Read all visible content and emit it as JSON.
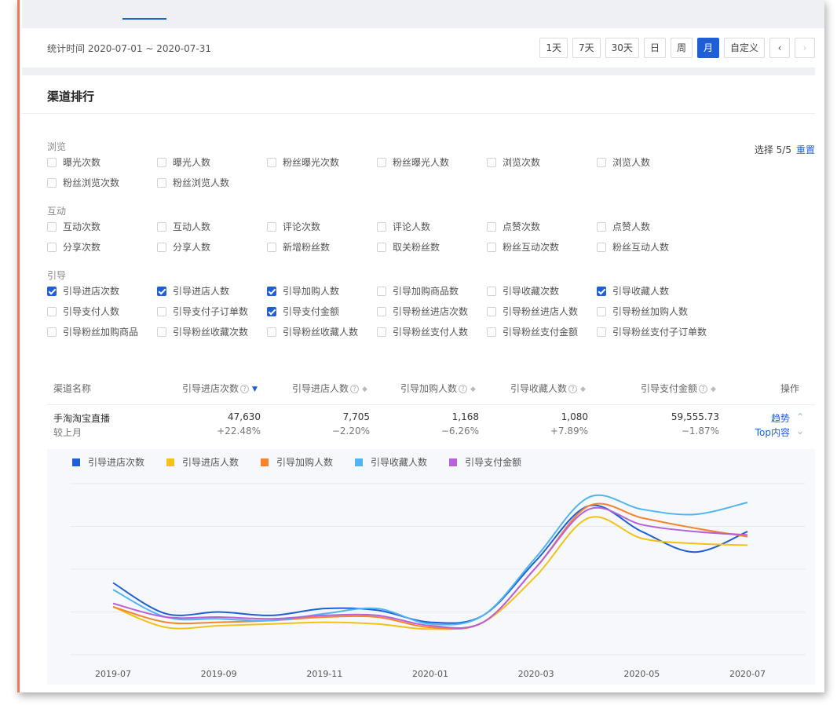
{
  "stat": {
    "label": "统计时间 2020-07-01 ~ 2020-07-31",
    "buttons": [
      "1天",
      "7天",
      "30天",
      "日",
      "周",
      "月",
      "自定义"
    ],
    "active_button": "月",
    "prev_icon": "‹",
    "next_icon": "›"
  },
  "panel": {
    "title": "渠道排行",
    "select_info": "选择 5/5",
    "reset_label": "重置"
  },
  "groups": [
    {
      "title": "浏览",
      "items": [
        {
          "label": "曝光次数",
          "checked": false
        },
        {
          "label": "曝光人数",
          "checked": false
        },
        {
          "label": "粉丝曝光次数",
          "checked": false
        },
        {
          "label": "粉丝曝光人数",
          "checked": false
        },
        {
          "label": "浏览次数",
          "checked": false
        },
        {
          "label": "浏览人数",
          "checked": false
        },
        {
          "label": "粉丝浏览次数",
          "checked": false
        },
        {
          "label": "粉丝浏览人数",
          "checked": false
        }
      ]
    },
    {
      "title": "互动",
      "items": [
        {
          "label": "互动次数",
          "checked": false
        },
        {
          "label": "互动人数",
          "checked": false
        },
        {
          "label": "评论次数",
          "checked": false
        },
        {
          "label": "评论人数",
          "checked": false
        },
        {
          "label": "点赞次数",
          "checked": false
        },
        {
          "label": "点赞人数",
          "checked": false
        },
        {
          "label": "分享次数",
          "checked": false
        },
        {
          "label": "分享人数",
          "checked": false
        },
        {
          "label": "新增粉丝数",
          "checked": false
        },
        {
          "label": "取关粉丝数",
          "checked": false
        },
        {
          "label": "粉丝互动次数",
          "checked": false
        },
        {
          "label": "粉丝互动人数",
          "checked": false
        }
      ]
    },
    {
      "title": "引导",
      "items": [
        {
          "label": "引导进店次数",
          "checked": true
        },
        {
          "label": "引导进店人数",
          "checked": true
        },
        {
          "label": "引导加购人数",
          "checked": true
        },
        {
          "label": "引导加购商品数",
          "checked": false
        },
        {
          "label": "引导收藏次数",
          "checked": false
        },
        {
          "label": "引导收藏人数",
          "checked": true
        },
        {
          "label": "引导支付人数",
          "checked": false
        },
        {
          "label": "引导支付子订单数",
          "checked": false
        },
        {
          "label": "引导支付金额",
          "checked": true
        },
        {
          "label": "引导粉丝进店次数",
          "checked": false
        },
        {
          "label": "引导粉丝进店人数",
          "checked": false
        },
        {
          "label": "引导粉丝加购人数",
          "checked": false
        },
        {
          "label": "引导粉丝加购商品",
          "checked": false
        },
        {
          "label": "引导粉丝收藏次数",
          "checked": false
        },
        {
          "label": "引导粉丝收藏人数",
          "checked": false
        },
        {
          "label": "引导粉丝支付人数",
          "checked": false
        },
        {
          "label": "引导粉丝支付金额",
          "checked": false
        },
        {
          "label": "引导粉丝支付子订单数",
          "checked": false
        }
      ]
    }
  ],
  "table": {
    "headers": {
      "channel": "渠道名称",
      "c1": "引导进店次数",
      "c2": "引导进店人数",
      "c3": "引导加购人数",
      "c4": "引导收藏人数",
      "c5": "引导支付金额",
      "op": "操作"
    },
    "row": {
      "name": "手淘淘宝直播",
      "compare_label": "较上月",
      "values": [
        "47,630",
        "7,705",
        "1,168",
        "1,080",
        "59,555.73"
      ],
      "changes": [
        "+22.48%",
        "−2.20%",
        "−6.26%",
        "+7.89%",
        "−1.87%"
      ],
      "trend_link": "趋势",
      "top_link": "Top内容"
    }
  },
  "colors": {
    "accent": "#1f5fd6"
  },
  "chart_data": {
    "type": "line",
    "x": [
      "2019-07",
      "2019-08",
      "2019-09",
      "2019-10",
      "2019-11",
      "2019-12",
      "2020-01",
      "2020-02",
      "2020-03",
      "2020-04",
      "2020-05",
      "2020-06",
      "2020-07"
    ],
    "xticks": [
      "2019-07",
      "2019-09",
      "2019-11",
      "2020-01",
      "2020-03",
      "2020-05",
      "2020-07"
    ],
    "series": [
      {
        "name": "引导进店次数",
        "color": "#1f5fd6",
        "values": [
          0.42,
          0.24,
          0.25,
          0.23,
          0.27,
          0.26,
          0.19,
          0.23,
          0.55,
          0.87,
          0.72,
          0.6,
          0.72
        ]
      },
      {
        "name": "引导进店人数",
        "color": "#f2c215",
        "values": [
          0.28,
          0.16,
          0.17,
          0.18,
          0.19,
          0.18,
          0.15,
          0.19,
          0.46,
          0.8,
          0.68,
          0.65,
          0.64
        ]
      },
      {
        "name": "引导加购人数",
        "color": "#f6832d",
        "values": [
          0.28,
          0.19,
          0.19,
          0.2,
          0.22,
          0.22,
          0.16,
          0.19,
          0.51,
          0.87,
          0.8,
          0.74,
          0.69
        ]
      },
      {
        "name": "引导收藏人数",
        "color": "#4fb5f0",
        "values": [
          0.38,
          0.22,
          0.21,
          0.2,
          0.24,
          0.27,
          0.18,
          0.23,
          0.57,
          0.92,
          0.85,
          0.82,
          0.89
        ]
      },
      {
        "name": "引导支付金额",
        "color": "#b762d9",
        "values": [
          0.3,
          0.22,
          0.22,
          0.21,
          0.23,
          0.23,
          0.17,
          0.19,
          0.51,
          0.85,
          0.76,
          0.72,
          0.7
        ]
      }
    ],
    "grid": true
  }
}
